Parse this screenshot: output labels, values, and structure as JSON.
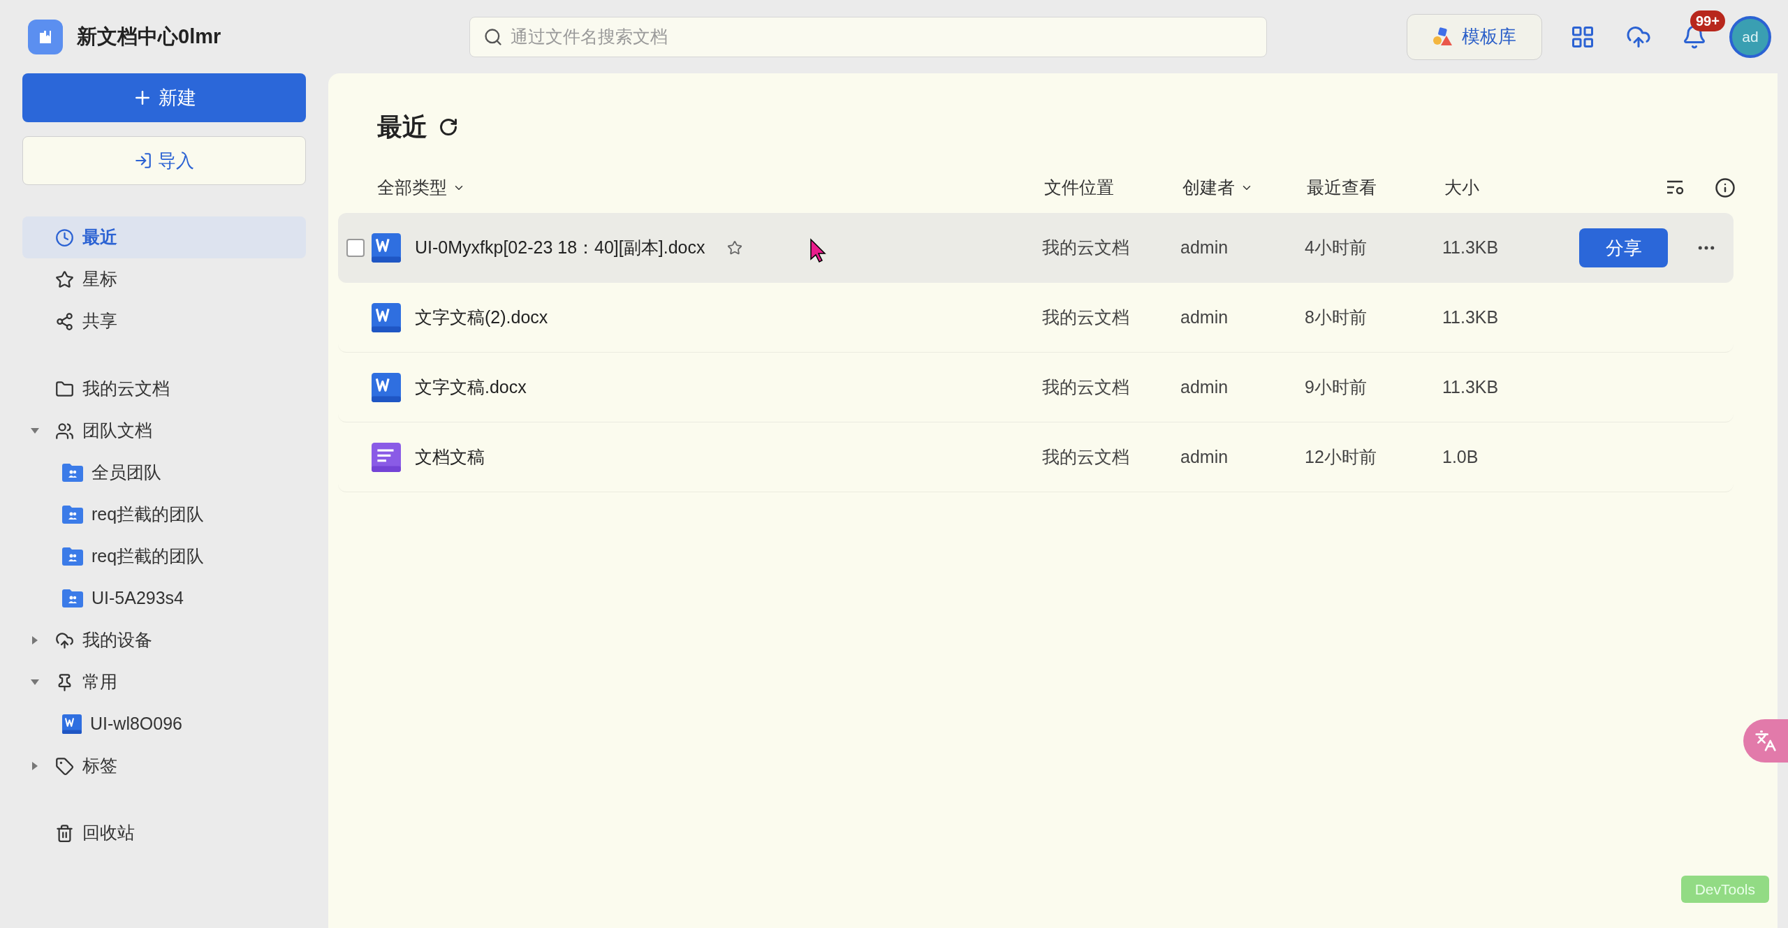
{
  "app": {
    "title": "新文档中心0lmr"
  },
  "search": {
    "placeholder": "通过文件名搜索文档"
  },
  "header": {
    "template_button": "模板库",
    "notification_badge": "99+",
    "avatar": "ad"
  },
  "sidebar": {
    "new_button": "新建",
    "import_button": "导入",
    "nav": [
      {
        "label": "最近",
        "kind": "clock",
        "selected": true
      },
      {
        "label": "星标",
        "kind": "star",
        "selected": false
      },
      {
        "label": "共享",
        "kind": "share",
        "selected": false
      }
    ],
    "tree": [
      {
        "label": "我的云文档",
        "kind": "folder",
        "selected": false
      },
      {
        "label": "团队文档",
        "kind": "users",
        "selected": false,
        "expanded": true,
        "children": [
          {
            "label": "全员团队",
            "kind": "team",
            "selected": false
          },
          {
            "label": "req拦截的团队",
            "kind": "team",
            "selected": false
          },
          {
            "label": "req拦截的团队",
            "kind": "team",
            "selected": false
          },
          {
            "label": "UI-5A293s4",
            "kind": "team",
            "selected": false
          }
        ]
      },
      {
        "label": "我的设备",
        "kind": "cloud",
        "selected": false,
        "expanded": false
      },
      {
        "label": "常用",
        "kind": "pin",
        "selected": false,
        "expanded": true,
        "children": [
          {
            "label": "UI-wl8O096",
            "kind": "word",
            "selected": false
          }
        ]
      },
      {
        "label": "标签",
        "kind": "tag",
        "selected": false,
        "expanded": false
      }
    ],
    "trash": {
      "label": "回收站",
      "kind": "trash",
      "selected": false
    }
  },
  "main": {
    "title": "最近",
    "columns": [
      {
        "label": "全部类型",
        "menu": true
      },
      {
        "label": "文件位置",
        "menu": false
      },
      {
        "label": "创建者",
        "menu": true
      },
      {
        "label": "最近查看",
        "menu": false
      },
      {
        "label": "大小",
        "menu": false
      }
    ],
    "rows": [
      {
        "kind": "word",
        "name": "UI-0Myxfkp[02-23 18：40][副本].docx",
        "location": "我的云文档",
        "creator": "admin",
        "viewed": "4小时前",
        "size": "11.3KB",
        "hovered": true,
        "share_label": "分享"
      },
      {
        "kind": "word",
        "name": "文字文稿(2).docx",
        "location": "我的云文档",
        "creator": "admin",
        "viewed": "8小时前",
        "size": "11.3KB",
        "hovered": false
      },
      {
        "kind": "word",
        "name": "文字文稿.docx",
        "location": "我的云文档",
        "creator": "admin",
        "viewed": "9小时前",
        "size": "11.3KB",
        "hovered": false
      },
      {
        "kind": "doc",
        "name": "文档文稿",
        "location": "我的云文档",
        "creator": "admin",
        "viewed": "12小时前",
        "size": "1.0B",
        "hovered": false
      }
    ]
  },
  "devtools": {
    "label": "DevTools"
  }
}
